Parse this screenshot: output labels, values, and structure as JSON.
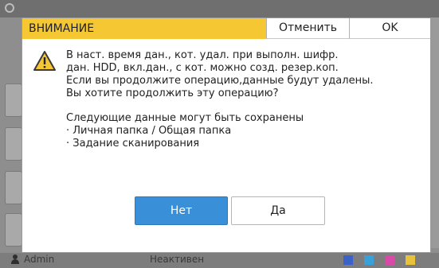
{
  "background": {
    "user_name": "Admin",
    "status_text": "Неактивен",
    "ink_colors": [
      "#3a62c9",
      "#3aa0d9",
      "#d94aa8",
      "#e8c23a"
    ]
  },
  "dialog": {
    "title": "ВНИМАНИЕ",
    "cancel_label": "Отменить",
    "ok_label": "OK",
    "icon": "warning-icon",
    "message_lines": [
      "В наст. время дан., кот. удал. при выполн. шифр.",
      "дан. HDD, вкл.дан., с кот. можно созд. резер.коп.",
      "Если вы продолжите операцию,данные будут удалены.",
      "Вы хотите продолжить эту операцию?"
    ],
    "saved_lines": [
      "Следующие данные могут быть сохранены",
      "· Личная папка / Общая папка",
      "· Задание сканирования"
    ],
    "no_label": "Нет",
    "yes_label": "Да",
    "colors": {
      "header": "#f5c733",
      "primary_button": "#3a8fd9"
    }
  }
}
